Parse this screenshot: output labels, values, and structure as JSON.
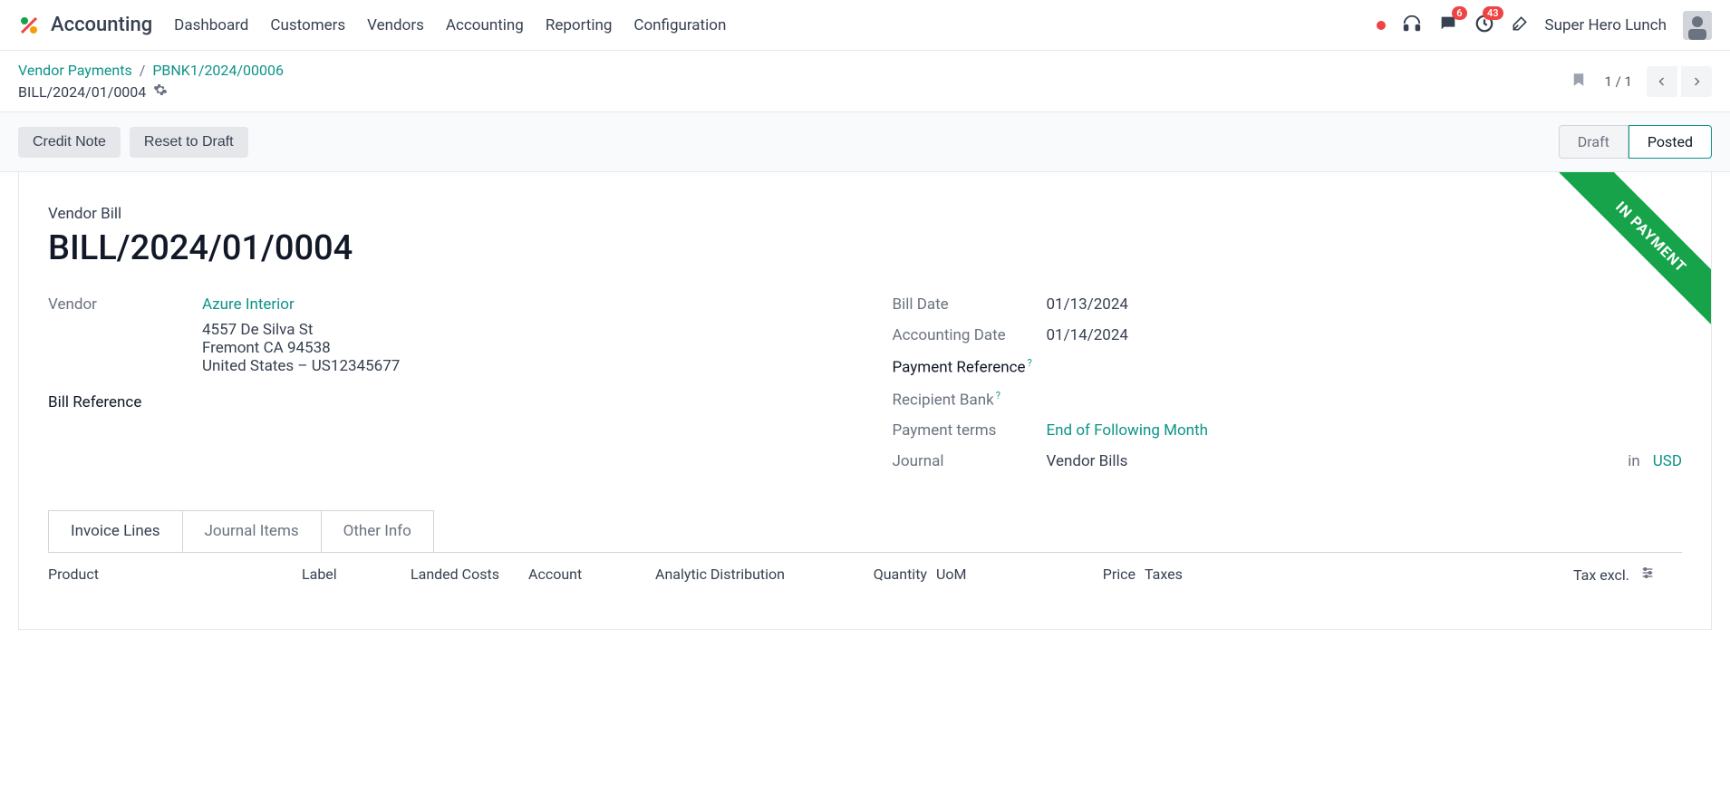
{
  "nav": {
    "app_name": "Accounting",
    "items": [
      "Dashboard",
      "Customers",
      "Vendors",
      "Accounting",
      "Reporting",
      "Configuration"
    ],
    "badges": {
      "messages": "6",
      "activities": "43"
    },
    "user": "Super Hero Lunch"
  },
  "breadcrumb": {
    "link1": "Vendor Payments",
    "link2": "PBNK1/2024/00006",
    "current": "BILL/2024/01/0004",
    "pager": "1 / 1"
  },
  "actions": {
    "credit_note": "Credit Note",
    "reset_draft": "Reset to Draft"
  },
  "status": {
    "draft": "Draft",
    "posted": "Posted"
  },
  "ribbon": "IN PAYMENT",
  "doc": {
    "type": "Vendor Bill",
    "name": "BILL/2024/01/0004"
  },
  "left": {
    "vendor_label": "Vendor",
    "vendor_name": "Azure Interior",
    "vendor_addr1": "4557 De Silva St",
    "vendor_addr2": "Fremont CA 94538",
    "vendor_addr3": "United States – US12345677",
    "bill_ref_label": "Bill Reference"
  },
  "right": {
    "bill_date_label": "Bill Date",
    "bill_date": "01/13/2024",
    "acct_date_label": "Accounting Date",
    "acct_date": "01/14/2024",
    "pay_ref_label": "Payment Reference",
    "bank_label": "Recipient Bank",
    "terms_label": "Payment terms",
    "terms_value": "End of Following Month",
    "journal_label": "Journal",
    "journal_value": "Vendor Bills",
    "in_label": "in",
    "currency": "USD"
  },
  "tabs": {
    "invoice_lines": "Invoice Lines",
    "journal_items": "Journal Items",
    "other_info": "Other Info"
  },
  "table": {
    "product": "Product",
    "label": "Label",
    "landed": "Landed Costs",
    "account": "Account",
    "analytic": "Analytic Distribution",
    "quantity": "Quantity",
    "uom": "UoM",
    "price": "Price",
    "taxes": "Taxes",
    "taxexcl": "Tax excl."
  }
}
